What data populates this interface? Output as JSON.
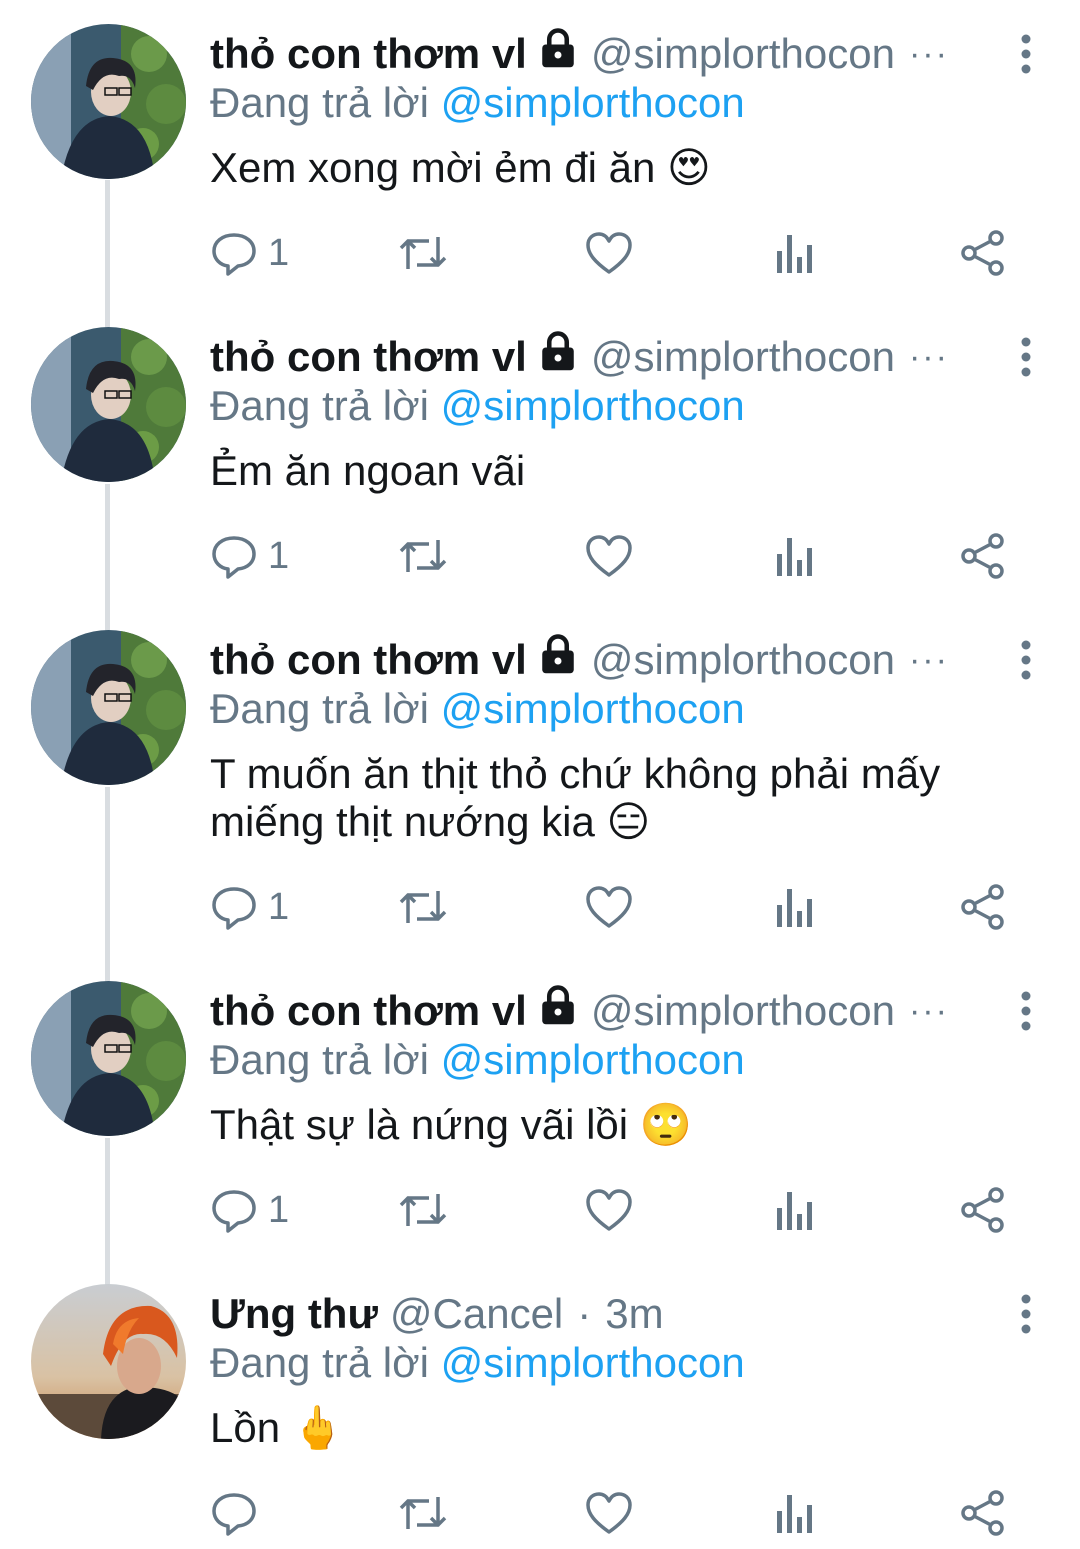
{
  "tweets": [
    {
      "display_name": "thỏ con thơm vl",
      "handle": "@simplorthocon",
      "replying_label": "Đang trả lời",
      "replying_to": "@simplorthocon",
      "text": "Xem xong mời ẻm đi ăn 😍",
      "reply_count": "1",
      "locked": true,
      "trailing": "···"
    },
    {
      "display_name": "thỏ con thơm vl",
      "handle": "@simplorthocon",
      "replying_label": "Đang trả lời",
      "replying_to": "@simplorthocon",
      "text": "Ẻm ăn ngoan vãi",
      "reply_count": "1",
      "locked": true,
      "trailing": "···"
    },
    {
      "display_name": "thỏ con thơm vl",
      "handle": "@simplorthocon",
      "replying_label": "Đang trả lời",
      "replying_to": "@simplorthocon",
      "text": "T muốn ăn thịt thỏ chứ không phải mấy miếng thịt nướng kia 😑",
      "reply_count": "1",
      "locked": true,
      "trailing": "···"
    },
    {
      "display_name": "thỏ con thơm vl",
      "handle": "@simplorthocon",
      "replying_label": "Đang trả lời",
      "replying_to": "@simplorthocon",
      "text": "Thật sự là nứng vãi lồi 🙄",
      "reply_count": "1",
      "locked": true,
      "trailing": "···"
    },
    {
      "display_name": "Ưng thư",
      "handle": "@Cancel",
      "separator": "·",
      "time": "3m",
      "replying_label": "Đang trả lời",
      "replying_to": "@simplorthocon",
      "text": "Lồn 🖕",
      "reply_count": "",
      "locked": false
    }
  ],
  "icons": {
    "reply": "reply-icon",
    "retweet": "retweet-icon",
    "like": "heart-icon",
    "analytics": "analytics-icon",
    "share": "share-icon",
    "more": "more-vertical-icon",
    "lock": "lock-icon"
  },
  "colors": {
    "text": "#14171a",
    "secondary": "#657786",
    "mention": "#1da1f2",
    "thread_line": "#d9dde1"
  }
}
